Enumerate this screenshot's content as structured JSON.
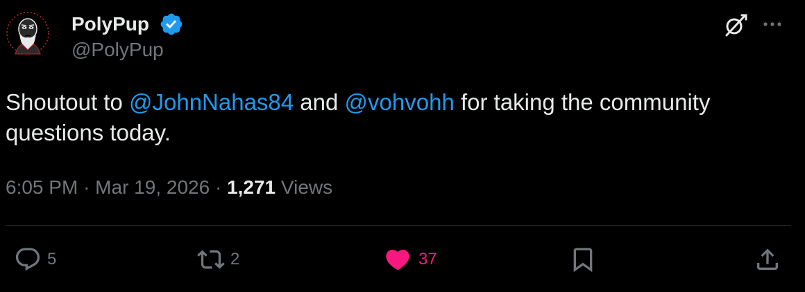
{
  "user": {
    "display_name": "PolyPup",
    "handle": "@PolyPup",
    "verified": true,
    "avatar_icon": "bearded-face-avatar"
  },
  "header_actions": {
    "grok_icon": "grok-icon",
    "more_icon": "more-icon"
  },
  "tweet": {
    "text_1": "Shoutout to ",
    "mention_1": "@JohnNahas84",
    "text_2": " and ",
    "mention_2": "@vohvohh",
    "text_3": " for taking the community questions today."
  },
  "meta": {
    "time": "6:05 PM",
    "separator": "·",
    "date": "Mar 19, 2026",
    "views_count": "1,271",
    "views_label": "Views"
  },
  "actions": {
    "replies": "5",
    "reposts": "2",
    "likes": "37"
  },
  "colors": {
    "background": "#000000",
    "text": "#e7e9ea",
    "secondary": "#71767b",
    "accent": "#1d9bf0",
    "like": "#f91880",
    "divider": "#2f3336"
  }
}
